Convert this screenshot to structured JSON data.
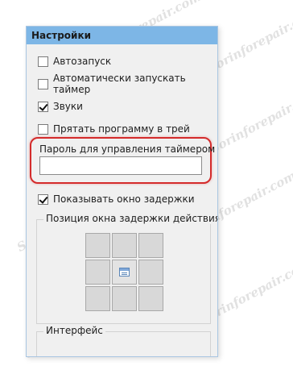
{
  "watermark": "Sorinforepair.com",
  "window": {
    "title": "Настройки"
  },
  "settings": {
    "autostart_label": "Автозапуск",
    "autostart_timer_label": "Автоматически запускать таймер",
    "sounds_label": "Звуки",
    "hide_to_tray_label": "Прятать программу в трей",
    "password_label": "Пароль для управления таймером",
    "password_value": "",
    "show_delay_window_label": "Показывать окно задержки",
    "delay_position_caption": "Позиция окна задержки действия",
    "interface_caption": "Интерфейс"
  },
  "checkbox_state": {
    "autostart": false,
    "autostart_timer": false,
    "sounds": true,
    "hide_to_tray": false,
    "show_delay_window": true
  },
  "delay_position": {
    "selected": "middle-center",
    "selected_icon": "window-icon"
  },
  "colors": {
    "title_bar": "#7db6e6",
    "highlight_outline": "#d42b2b",
    "panel_background": "#f0f0f0"
  }
}
